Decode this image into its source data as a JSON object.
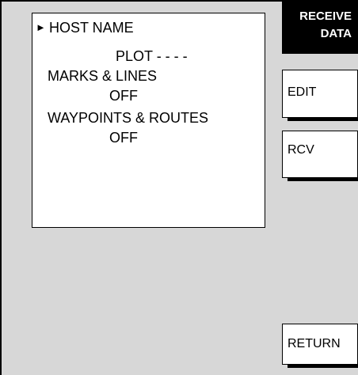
{
  "list": {
    "cursor_icon": "right-triangle-icon",
    "items": [
      {
        "label": "HOST NAME"
      },
      {
        "value": "PLOT - - - -"
      },
      {
        "label": "MARKS & LINES"
      },
      {
        "value": "OFF"
      },
      {
        "label": "WAYPOINTS & ROUTES"
      },
      {
        "value": "OFF"
      }
    ]
  },
  "softkeys": {
    "receive_data": {
      "line1": "RECEIVE",
      "line2": "DATA"
    },
    "edit": "EDIT",
    "rcv": "RCV",
    "return": "RETURN"
  }
}
